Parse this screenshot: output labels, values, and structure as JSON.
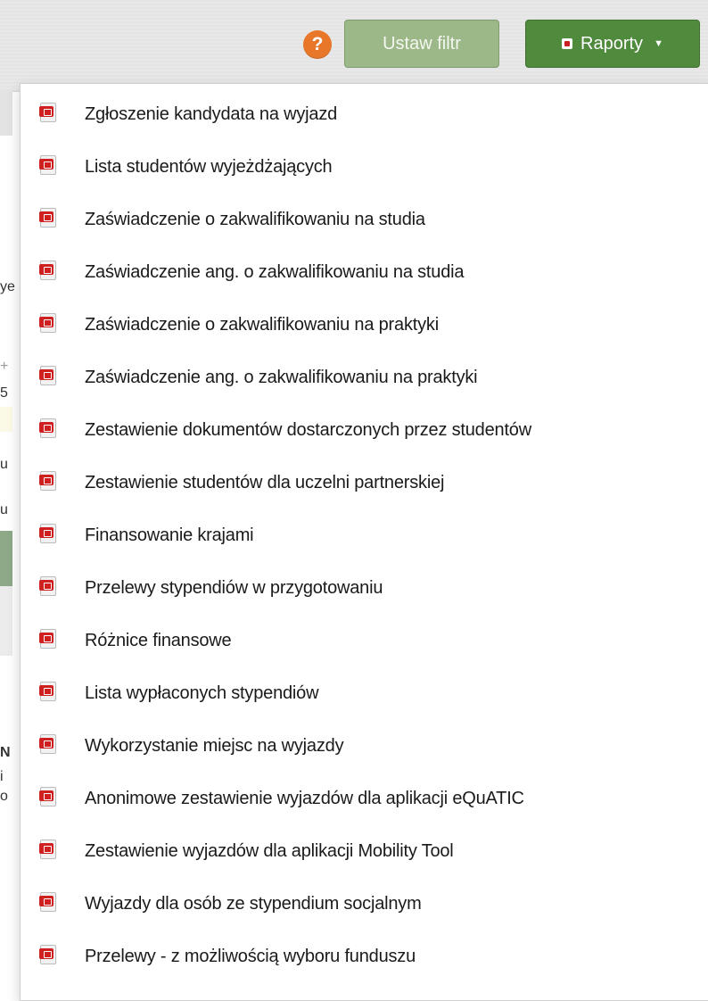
{
  "toolbar": {
    "help_symbol": "?",
    "filter_label": "Ustaw filtr",
    "reports_label": "Raporty",
    "caret": "▼"
  },
  "left_fragments": [
    "ye",
    "+",
    "5",
    "u",
    "u",
    "N",
    "i",
    "o"
  ],
  "menu": {
    "items": [
      "Zgłoszenie kandydata na wyjazd",
      "Lista studentów wyjeżdżających",
      "Zaświadczenie o zakwalifikowaniu na studia",
      "Zaświadczenie ang. o zakwalifikowaniu na studia",
      "Zaświadczenie o zakwalifikowaniu na praktyki",
      "Zaświadczenie ang. o zakwalifikowaniu na praktyki",
      "Zestawienie dokumentów dostarczonych przez studentów",
      "Zestawienie studentów dla uczelni partnerskiej",
      "Finansowanie krajami",
      "Przelewy stypendiów w przygotowaniu",
      "Różnice finansowe",
      "Lista wypłaconych stypendiów",
      "Wykorzystanie miejsc na wyjazdy",
      "Anonimowe zestawienie wyjazdów dla aplikacji eQuATIC",
      "Zestawienie wyjazdów dla aplikacji Mobility Tool",
      "Wyjazdy dla osób ze stypendium socjalnym",
      "Przelewy - z możliwością wyboru funduszu"
    ]
  }
}
